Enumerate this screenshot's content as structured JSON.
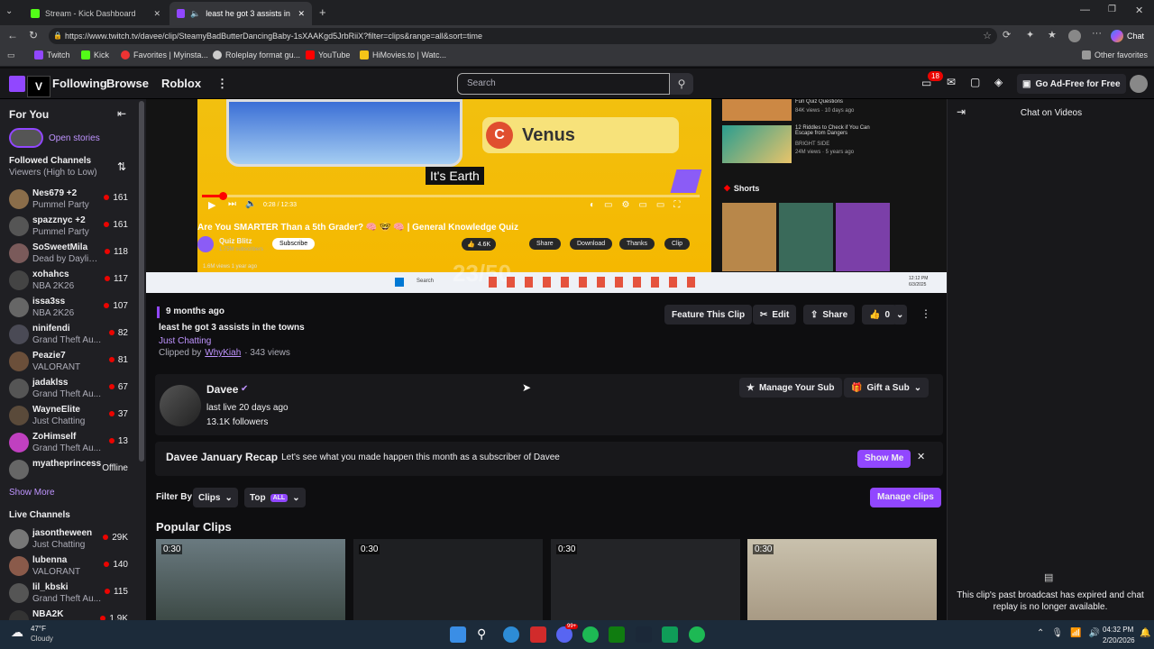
{
  "browser": {
    "tabs": [
      {
        "label": "Stream - Kick Dashboard"
      },
      {
        "label": "least he got 3 assists in the to"
      }
    ],
    "url": "https://www.twitch.tv/davee/clip/SteamyBadButterDancingBaby-1sXAAKgd5JrbRiiX?filter=clips&range=all&sort=time",
    "favorites": [
      "Twitch",
      "Kick",
      "Favorites | Myinsta...",
      "Roleplay format gu...",
      "YouTube",
      "HiMovies.to | Watc...",
      "Other favorites"
    ],
    "chat_button": "Chat"
  },
  "topnav": {
    "following": "Following",
    "browse": "Browse",
    "roblox": "Roblox",
    "search_placeholder": "Search",
    "notif_count": "18",
    "ad_free": "Go Ad-Free for Free"
  },
  "sidebar": {
    "for_you": "For You",
    "open_stories": "Open stories",
    "followed_title": "Followed Channels",
    "followed_sort": "Viewers (High to Low)",
    "followed": [
      {
        "name": "Nes679 +2",
        "game": "Pummel Party",
        "viewers": "161",
        "color": "#8a6d4a"
      },
      {
        "name": "spazznyc +2",
        "game": "Pummel Party",
        "viewers": "161",
        "color": "#555"
      },
      {
        "name": "SoSweetMila",
        "game": "Dead by Daylight",
        "viewers": "118",
        "color": "#7a5a5a"
      },
      {
        "name": "xohahcs",
        "game": "NBA 2K26",
        "viewers": "117",
        "color": "#444"
      },
      {
        "name": "issa3ss",
        "game": "NBA 2K26",
        "viewers": "107",
        "color": "#666"
      },
      {
        "name": "ninifendi",
        "game": "Grand Theft Au...",
        "viewers": "82",
        "color": "#4a4a55"
      },
      {
        "name": "Peazie7",
        "game": "VALORANT",
        "viewers": "81",
        "color": "#6b4f3a"
      },
      {
        "name": "jadaklss",
        "game": "Grand Theft Au...",
        "viewers": "67",
        "color": "#555"
      },
      {
        "name": "WayneElite",
        "game": "Just Chatting",
        "viewers": "37",
        "color": "#5a4a3a"
      },
      {
        "name": "ZoHimself",
        "game": "Grand Theft Au...",
        "viewers": "13",
        "color": "#c040c0"
      },
      {
        "name": "myatheprincess",
        "game": "",
        "viewers": "Offline",
        "color": "#666"
      }
    ],
    "show_more": "Show More",
    "live_title": "Live Channels",
    "live": [
      {
        "name": "jasontheween",
        "game": "Just Chatting",
        "viewers": "29K",
        "color": "#777"
      },
      {
        "name": "lubenna",
        "game": "VALORANT",
        "viewers": "140",
        "color": "#8a5a4a"
      },
      {
        "name": "lil_kbski",
        "game": "Grand Theft Au...",
        "viewers": "115",
        "color": "#555"
      },
      {
        "name": "NBA2K",
        "game": "",
        "viewers": "1.9K",
        "color": "#333"
      }
    ]
  },
  "video": {
    "option_c": "C",
    "venus": "Venus",
    "caption": "It's Earth",
    "yt_title": "Are You SMARTER Than a 5th Grader? 🧠 🤓 🧠 | General Knowledge Quiz",
    "channel": "Quiz Blitz",
    "subs": "1.75M subscribers",
    "subscribe": "Subscribe",
    "likes": "4.6K",
    "share": "Share",
    "download": "Download",
    "thanks": "Thanks",
    "clip": "Clip",
    "views": "1.6M views  1 year ago",
    "time": "0:28 / 12:33",
    "score": "23/50",
    "side_title1": "Fun Quiz Questions",
    "side_meta1": "84K views · 10 days ago",
    "side_title2": "12 Riddles to Check if You Can Escape from Dangers",
    "side_channel2": "BRIGHT SIDE",
    "side_meta2": "24M views · 5 years ago",
    "shorts": "Shorts",
    "tb_search": "Search",
    "tb_time": "12:12 PM",
    "tb_date": "6/3/2025"
  },
  "clip": {
    "age": "9 months ago",
    "title": "least he got 3 assists in the towns",
    "category": "Just Chatting",
    "clipped_by_prefix": "Clipped by",
    "clipper": "WhyKiah",
    "views": "· 343 views",
    "feature": "Feature This Clip",
    "edit": "Edit",
    "share": "Share",
    "likes": "0"
  },
  "channel": {
    "name": "Davee",
    "last_live": "last live 20 days ago",
    "followers": "13.1K followers",
    "manage_sub": "Manage Your Sub",
    "gift_sub": "Gift a Sub"
  },
  "recap": {
    "title": "Davee January Recap",
    "text": "Let's see what you made happen this month as a subscriber of Davee",
    "show_me": "Show Me"
  },
  "filters": {
    "filter_by": "Filter By",
    "clips": "Clips",
    "top": "Top",
    "all": "ALL",
    "manage_clips": "Manage clips"
  },
  "popular": {
    "title": "Popular Clips",
    "durations": [
      "0:30",
      "0:30",
      "0:30",
      "0:30"
    ]
  },
  "chat": {
    "title": "Chat on Videos",
    "expired": "This clip's past broadcast has expired and chat replay is no longer available."
  },
  "taskbar": {
    "temp": "47°F",
    "weather": "Cloudy",
    "time": "04:32 PM",
    "date": "2/20/2026",
    "badge": "99+"
  },
  "colors": {
    "accent": "#9147ff",
    "live": "#eb0400",
    "link": "#bf94ff"
  }
}
